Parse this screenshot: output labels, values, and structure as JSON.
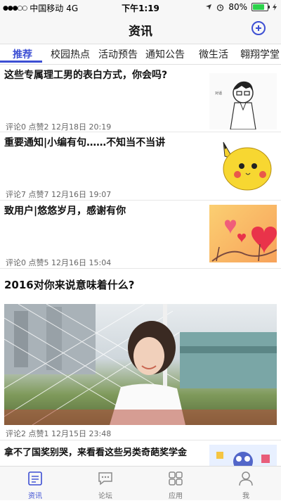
{
  "status": {
    "signal": "●●●○○",
    "carrier": "中国移动",
    "network": "4G",
    "time": "下午1:19",
    "battery_pct": "80%"
  },
  "header": {
    "title": "资讯",
    "add_icon": "plus-circle-icon"
  },
  "tabs": [
    {
      "label": "推荐",
      "active": true
    },
    {
      "label": "校园热点"
    },
    {
      "label": "活动预告"
    },
    {
      "label": "通知公告"
    },
    {
      "label": "微生活"
    },
    {
      "label": "翱翔学堂"
    }
  ],
  "articles": [
    {
      "title": "这些专属理工男的表白方式，你会吗?",
      "comments": "评论0",
      "likes": "点赞2",
      "date": "12月18日 20:19",
      "thumb": "cartoon-guy-image"
    },
    {
      "title": "重要通知|小编有句……不知当不当讲",
      "comments": "评论7",
      "likes": "点赞7",
      "date": "12月16日 19:07",
      "thumb": "pikachu-image"
    },
    {
      "title": "致用户|悠悠岁月，感谢有你",
      "comments": "评论0",
      "likes": "点赞5",
      "date": "12月16日 15:04",
      "thumb": "hearts-image"
    },
    {
      "title": "2016对你来说意味着什么?",
      "comments": "评论2",
      "likes": "点赞1",
      "date": "12月15日 23:48",
      "thumb": "girl-goal-net-photo"
    },
    {
      "title": "拿不了国奖别哭，来看看这些另类奇葩奖学金",
      "thumb": "cartoon-image"
    }
  ],
  "bottom_tabs": [
    {
      "label": "资讯",
      "icon": "news-icon",
      "active": true
    },
    {
      "label": "论坛",
      "icon": "chat-bubble-icon"
    },
    {
      "label": "应用",
      "icon": "grid-apps-icon"
    },
    {
      "label": "我",
      "icon": "person-icon"
    }
  ],
  "colors": {
    "accent": "#3d4fd3",
    "battery": "#2bd24a"
  }
}
